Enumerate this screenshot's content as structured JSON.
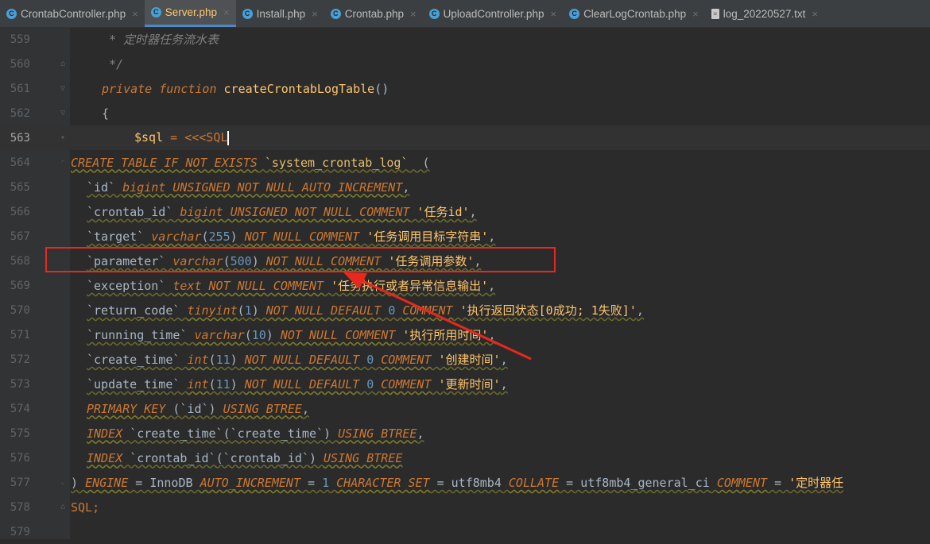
{
  "tabs": [
    {
      "label": "CrontabController.php",
      "icon": "php-class-icon",
      "active": false
    },
    {
      "label": "Server.php",
      "icon": "php-class-icon",
      "active": true
    },
    {
      "label": "Install.php",
      "icon": "php-class-icon",
      "active": false
    },
    {
      "label": "Crontab.php",
      "icon": "php-class-icon",
      "active": false
    },
    {
      "label": "UploadController.php",
      "icon": "php-class-icon",
      "active": false
    },
    {
      "label": "ClearLogCrontab.php",
      "icon": "php-class-icon",
      "active": false
    },
    {
      "label": "log_20220527.txt",
      "icon": "text-file-icon",
      "active": false
    }
  ],
  "editor": {
    "current_line": "563",
    "lines": [
      {
        "n": "559",
        "t": [
          "* 定时器任务流水表"
        ]
      },
      {
        "n": "560",
        "t": [
          "*/"
        ]
      },
      {
        "n": "561",
        "t": [
          "private function",
          "createCrontabLogTable",
          "()"
        ]
      },
      {
        "n": "562",
        "t": [
          "{"
        ]
      },
      {
        "n": "563",
        "t": [
          "$sql",
          " = ",
          "<<<SQL"
        ]
      },
      {
        "n": "564",
        "t": [
          "CREATE TABLE IF NOT EXISTS",
          "`system_crontab_log`",
          "  ("
        ]
      },
      {
        "n": "565",
        "t": [
          "`id`",
          "bigint UNSIGNED NOT NULL AUTO_INCREMENT",
          ","
        ]
      },
      {
        "n": "566",
        "t": [
          "`crontab_id`",
          "bigint UNSIGNED NOT NULL COMMENT",
          "'任务id'",
          ","
        ]
      },
      {
        "n": "567",
        "t": [
          "`target`",
          "varchar",
          "(",
          "255",
          ")",
          "NOT NULL COMMENT",
          "'任务调用目标字符串'",
          ","
        ]
      },
      {
        "n": "568",
        "t": [
          "`parameter`",
          "varchar",
          "(",
          "500",
          ")",
          "NOT NULL COMMENT",
          "'任务调用参数'",
          ","
        ]
      },
      {
        "n": "569",
        "t": [
          "`exception`",
          "text NOT NULL COMMENT",
          "'任务执行或者异常信息输出'",
          ","
        ]
      },
      {
        "n": "570",
        "t": [
          "`return_code`",
          "tinyint",
          "(",
          "1",
          ")",
          "NOT NULL DEFAULT",
          "0",
          "COMMENT",
          "'执行返回状态[0成功; 1失败]'",
          ","
        ]
      },
      {
        "n": "571",
        "t": [
          "`running_time`",
          "varchar",
          "(",
          "10",
          ")",
          "NOT NULL COMMENT",
          "'执行所用时间'",
          ","
        ]
      },
      {
        "n": "572",
        "t": [
          "`create_time`",
          "int",
          "(",
          "11",
          ")",
          "NOT NULL DEFAULT",
          "0",
          "COMMENT",
          "'创建时间'",
          ","
        ]
      },
      {
        "n": "573",
        "t": [
          "`update_time`",
          "int",
          "(",
          "11",
          ")",
          "NOT NULL DEFAULT",
          "0",
          "COMMENT",
          "'更新时间'",
          ","
        ]
      },
      {
        "n": "574",
        "t": [
          "PRIMARY KEY",
          "(",
          "`id`",
          ")",
          "USING BTREE",
          ","
        ]
      },
      {
        "n": "575",
        "t": [
          "INDEX",
          "`create_time`",
          "(",
          "`create_time`",
          ")",
          "USING BTREE",
          ","
        ]
      },
      {
        "n": "576",
        "t": [
          "INDEX",
          "`crontab_id`",
          "(",
          "`crontab_id`",
          ")",
          "USING BTREE"
        ]
      },
      {
        "n": "577",
        "t": [
          ")",
          "ENGINE",
          "=",
          "InnoDB",
          "AUTO_INCREMENT",
          "=",
          "1",
          "CHARACTER SET",
          "=",
          "utf8mb4",
          "COLLATE",
          "=",
          "utf8mb4_general_ci",
          "COMMENT",
          "=",
          "'定时器任"
        ]
      },
      {
        "n": "578",
        "t": [
          "SQL",
          ";"
        ]
      },
      {
        "n": "579",
        "t": []
      }
    ]
  },
  "annotation": {
    "color": "#e8281e",
    "highlighted_line": "568"
  }
}
